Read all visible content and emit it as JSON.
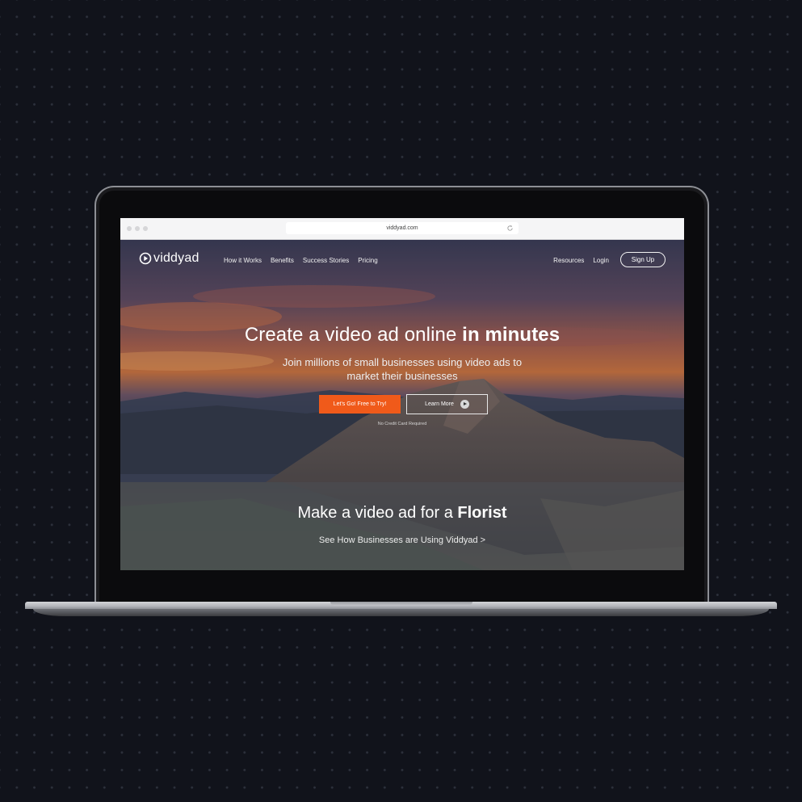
{
  "browser": {
    "url": "viddyad.com"
  },
  "nav": {
    "logo_text": "viddyad",
    "links": [
      "How it Works",
      "Benefits",
      "Success Stories",
      "Pricing"
    ],
    "right_links": [
      "Resources",
      "Login"
    ],
    "signup_label": "Sign Up"
  },
  "hero": {
    "title_light": "Create a video ad online ",
    "title_bold": "in minutes",
    "subtitle": "Join millions of small businesses using video ads to market their businesses",
    "cta_primary": "Let's Go! Free to Try!",
    "cta_secondary": "Learn More",
    "note": "No Credit Card Required"
  },
  "band": {
    "title_light": "Make a video ad for a ",
    "title_bold": "Florist",
    "link": "See How Businesses are Using Viddyad >"
  },
  "colors": {
    "background": "#11131b",
    "accent_orange": "#f05a1a",
    "text_white": "#ffffff"
  },
  "icons": [
    "play-circle-logo-icon",
    "reload-icon",
    "play-icon"
  ]
}
